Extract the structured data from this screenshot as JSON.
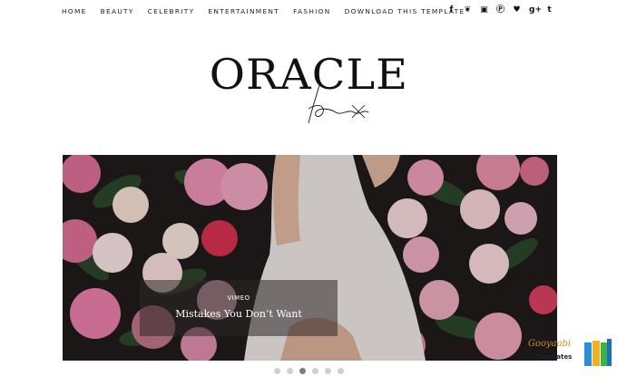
{
  "nav": {
    "items": [
      "HOME",
      "BEAUTY",
      "CELEBRITY",
      "ENTERTAINMENT",
      "FASHION",
      "DOWNLOAD THIS TEMPLATE"
    ]
  },
  "social": {
    "icons": [
      {
        "name": "facebook-icon",
        "glyph": "f"
      },
      {
        "name": "twitter-icon",
        "glyph": "❦"
      },
      {
        "name": "instagram-icon",
        "glyph": "▣"
      },
      {
        "name": "pinterest-icon",
        "glyph": "Ⓟ"
      },
      {
        "name": "heart-icon",
        "glyph": "♥"
      },
      {
        "name": "google-plus-icon",
        "glyph": "g+"
      },
      {
        "name": "tumblr-icon",
        "glyph": "t"
      }
    ]
  },
  "logo": {
    "word": "ORACLE",
    "script": "fox"
  },
  "slider": {
    "label": "VIMEO",
    "title": "Mistakes You Don’t Want",
    "dots": 6,
    "active_dot": 3
  },
  "watermark": {
    "text": "Gooyaabi",
    "sub": "Templates"
  },
  "colors": {
    "accent": "#111111",
    "caption_bg": "#2d2828",
    "rose": "#e58fb0",
    "leaf": "#2d4a2c"
  }
}
